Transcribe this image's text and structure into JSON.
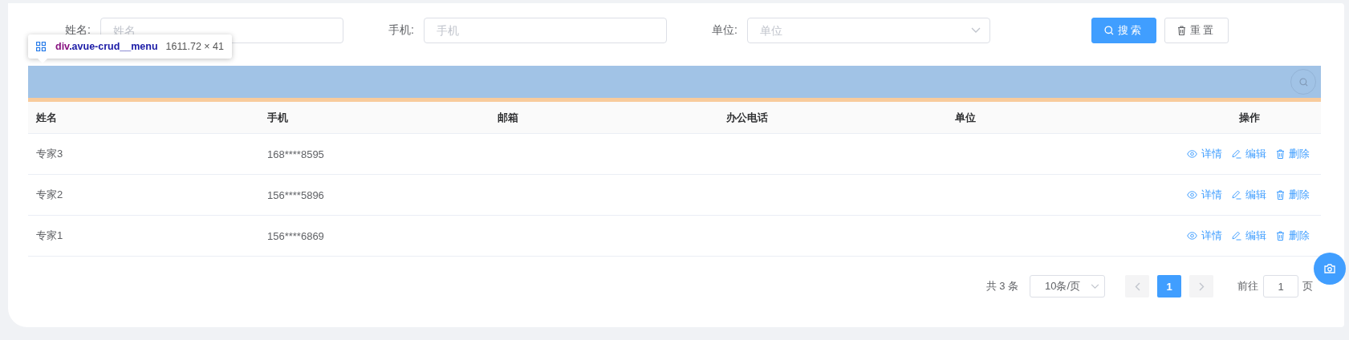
{
  "search_form": {
    "fields": [
      {
        "kind": "input",
        "label": "姓名:",
        "placeholder": "姓名"
      },
      {
        "kind": "input",
        "label": "手机:",
        "placeholder": "手机"
      },
      {
        "kind": "select",
        "label": "单位:",
        "placeholder": "单位"
      }
    ],
    "buttons": [
      {
        "kind": "search",
        "label": "搜索"
      },
      {
        "kind": "reset",
        "label": "重置"
      }
    ]
  },
  "inspector_tooltip": {
    "tag": "div",
    "selector": ".avue-crud__menu",
    "size": "1611.72 × 41"
  },
  "table": {
    "columns": [
      "姓名",
      "手机",
      "邮箱",
      "办公电话",
      "单位",
      "操作"
    ],
    "rows": [
      {
        "cells": [
          "专家3",
          "168****8595"
        ],
        "actions": [
          {
            "kind": "view",
            "label": "详情"
          },
          {
            "kind": "edit",
            "label": "编辑"
          },
          {
            "kind": "delete",
            "label": "删除"
          }
        ]
      },
      {
        "cells": [
          "专家2",
          "156****5896"
        ],
        "actions": [
          {
            "kind": "view",
            "label": "详情"
          },
          {
            "kind": "edit",
            "label": "编辑"
          },
          {
            "kind": "delete",
            "label": "删除"
          }
        ]
      },
      {
        "cells": [
          "专家1",
          "156****6869"
        ],
        "actions": [
          {
            "kind": "view",
            "label": "详情"
          },
          {
            "kind": "edit",
            "label": "编辑"
          },
          {
            "kind": "delete",
            "label": "删除"
          }
        ]
      }
    ]
  },
  "pagination": {
    "total": "共 3 条",
    "page_size": "10条/页",
    "prev": {
      "disabled": true
    },
    "pages": [
      {
        "label": "1",
        "selected": true
      }
    ],
    "next": {
      "disabled": true
    },
    "goto_label": "前往",
    "goto_value": "1",
    "goto_suffix": "页"
  }
}
